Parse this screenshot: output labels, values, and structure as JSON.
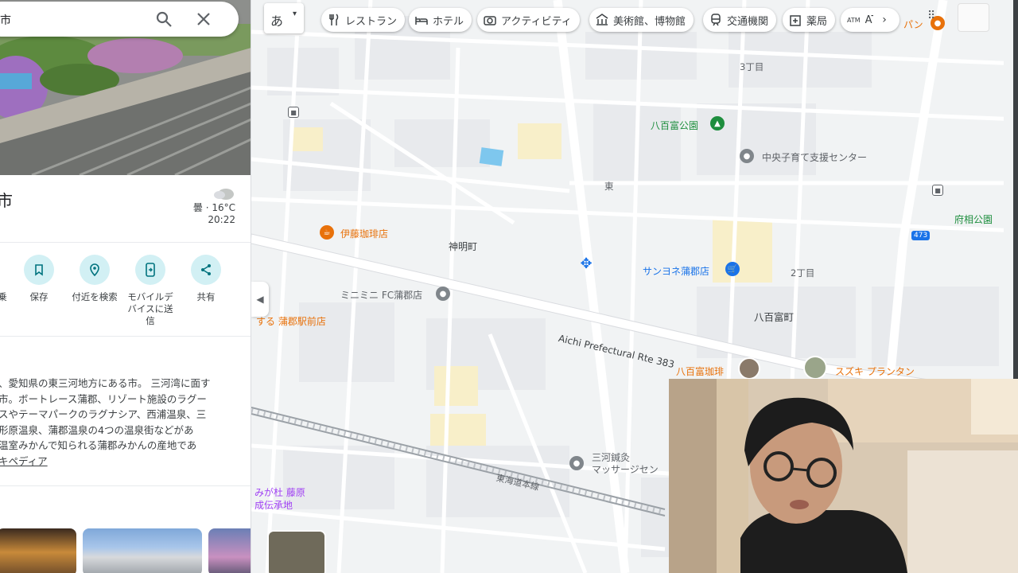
{
  "search": {
    "query": "市"
  },
  "place": {
    "title": "市",
    "weather": "曇 · 16°C",
    "time": "20:22",
    "actions": [
      {
        "label": "乗",
        "icon": "directions-icon"
      },
      {
        "label": "保存",
        "icon": "bookmark-icon"
      },
      {
        "label": "付近を検索",
        "icon": "nearby-search-icon"
      },
      {
        "label": "モバイルデバイスに送信",
        "icon": "send-to-phone-icon"
      },
      {
        "label": "共有",
        "icon": "share-icon"
      }
    ],
    "description": [
      "、愛知県の東三河地方にある市。 三河湾に面す",
      "市。ボートレース蒲郡、リゾート施設のラグー",
      "スやテーマパークのラグナシア、西浦温泉、三",
      "形原温泉、蒲郡温泉の4つの温泉街などがあ",
      "温室みかんで知られる蒲郡みかんの産地であ"
    ],
    "wiki_link": "キペディア"
  },
  "top_bar": {
    "lang_button": "あ",
    "chips": [
      {
        "label": "レストラン",
        "icon": "fork-knife-icon"
      },
      {
        "label": "ホテル",
        "icon": "bed-icon"
      },
      {
        "label": "アクティビティ",
        "icon": "camera-icon"
      },
      {
        "label": "美術館、博物館",
        "icon": "museum-icon"
      },
      {
        "label": "交通機関",
        "icon": "train-icon"
      },
      {
        "label": "薬局",
        "icon": "pharmacy-icon"
      },
      {
        "label": "AT",
        "icon": "atm-icon"
      }
    ]
  },
  "map": {
    "labels": {
      "chome3": "3丁目",
      "yaotomi_park": "八百富公園",
      "childcare_center": "中央子育て支援センター",
      "higashi": "東",
      "fuso_park": "府相公園",
      "ito_coffee": "伊藤珈琲店",
      "shinmei": "神明町",
      "sanyone": "サンヨネ蒲郡店",
      "chome2": "2丁目",
      "ministop": "ミニミニ FC蒲郡店",
      "gamagori_ekimae": "する 蒲郡駅前店",
      "yaotomicho": "八百富町",
      "route383": "Aichi Prefectural Rte 383",
      "yaotomi_coffee": "八百富珈琲",
      "suzuki_plantan": "スズキ プランタン",
      "mikawa_acupuncture": "三河鍼灸\nマッサージセン",
      "tokaido_line": "東海道本線",
      "fujiwara_1": "みが杜 藤原",
      "fujiwara_2": "成伝承地",
      "route_badge": "473",
      "top_label": "パン"
    }
  },
  "colors": {
    "accent": "#1a73e8",
    "poi_orange": "#e8710a",
    "poi_green": "#1e8e3e",
    "poi_blue": "#1a73e8",
    "action_bg": "#d2f0f4"
  }
}
